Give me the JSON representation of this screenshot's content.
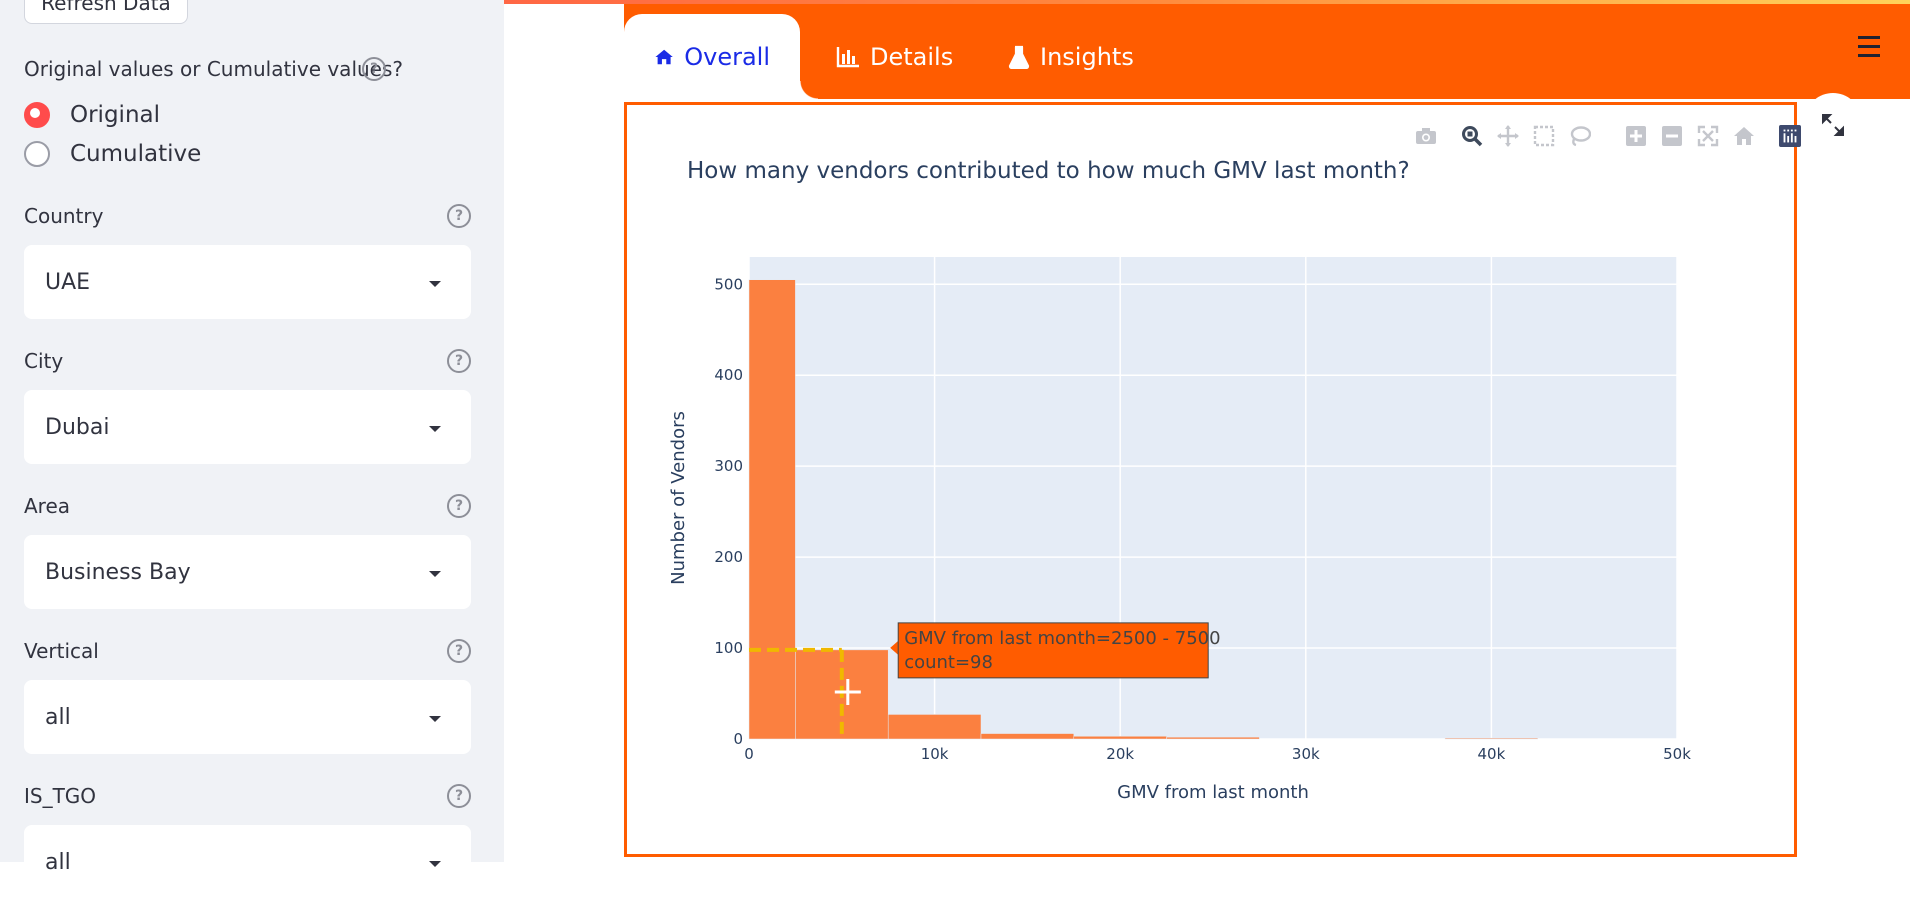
{
  "sidebar": {
    "refresh_label": "Refresh Data",
    "value_mode_label": "Original values or Cumulative values?",
    "radio_options": [
      "Original",
      "Cumulative"
    ],
    "selected_option": "Original",
    "filters": [
      {
        "label": "Country",
        "value": "UAE"
      },
      {
        "label": "City",
        "value": "Dubai"
      },
      {
        "label": "Area",
        "value": "Business Bay"
      },
      {
        "label": "Vertical",
        "value": "all"
      },
      {
        "label": "IS_TGO",
        "value": "all"
      }
    ]
  },
  "tabs": [
    {
      "label": "Overall",
      "icon": "home-icon",
      "active": true
    },
    {
      "label": "Details",
      "icon": "bar-chart-icon",
      "active": false
    },
    {
      "label": "Insights",
      "icon": "flask-icon",
      "active": false
    }
  ],
  "colors": {
    "accent": "#ff5c00",
    "bar": "#fb8040",
    "tab_active_text": "#1a2be6",
    "radio": "#ff4b4b"
  },
  "modebar_icons": [
    "camera-icon",
    "zoom-icon",
    "pan-icon",
    "box-select-icon",
    "lasso-icon",
    "zoom-in-icon",
    "zoom-out-icon",
    "autoscale-icon",
    "reset-axes-icon",
    "plotly-logo-icon"
  ],
  "chart": {
    "title": "How many vendors contributed to how much GMV last month?",
    "tooltip_line1": "GMV from last month=2500 - 7500",
    "tooltip_line2": "count=98"
  },
  "chart_data": {
    "type": "bar",
    "title": "How many vendors contributed to how much GMV last month?",
    "xlabel": "GMV from last month",
    "ylabel": "Number of Vendors",
    "xlim": [
      0,
      50000
    ],
    "ylim": [
      0,
      530
    ],
    "x_ticks": [
      0,
      10000,
      20000,
      30000,
      40000,
      50000
    ],
    "x_tick_labels": [
      "0",
      "10k",
      "20k",
      "30k",
      "40k",
      "50k"
    ],
    "y_ticks": [
      0,
      100,
      200,
      300,
      400,
      500
    ],
    "y_tick_labels": [
      "0",
      "100",
      "200",
      "300",
      "400",
      "500"
    ],
    "bins": [
      {
        "x0": 0,
        "x1": 2500,
        "count": 505
      },
      {
        "x0": 2500,
        "x1": 7500,
        "count": 98
      },
      {
        "x0": 7500,
        "x1": 12500,
        "count": 27
      },
      {
        "x0": 12500,
        "x1": 17500,
        "count": 6
      },
      {
        "x0": 17500,
        "x1": 22500,
        "count": 3
      },
      {
        "x0": 22500,
        "x1": 27500,
        "count": 2
      },
      {
        "x0": 37500,
        "x1": 42500,
        "count": 1
      }
    ],
    "hovered_bin_index": 1,
    "grid": true
  }
}
